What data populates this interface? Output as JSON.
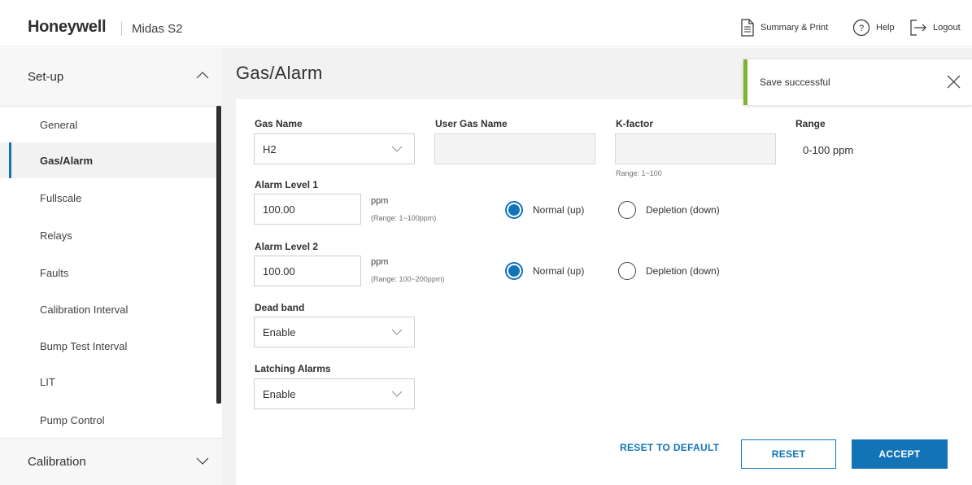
{
  "header": {
    "brand": "Honeywell",
    "product": "Midas S2",
    "summary_print": "Summary & Print",
    "help": "Help",
    "logout": "Logout"
  },
  "sidebar": {
    "setup_label": "Set-up",
    "calibration_label": "Calibration",
    "items": [
      {
        "label": "General"
      },
      {
        "label": "Gas/Alarm"
      },
      {
        "label": "Fullscale"
      },
      {
        "label": "Relays"
      },
      {
        "label": "Faults"
      },
      {
        "label": "Calibration Interval"
      },
      {
        "label": "Bump Test Interval"
      },
      {
        "label": "LIT"
      },
      {
        "label": "Pump Control"
      }
    ],
    "active_item": "Gas/Alarm"
  },
  "main": {
    "title": "Gas/Alarm",
    "form": {
      "gas_name_label": "Gas Name",
      "gas_name_value": "H2",
      "user_gas_name_label": "User Gas Name",
      "user_gas_name_value": "",
      "kfactor_label": "K-factor",
      "kfactor_value": "",
      "kfactor_hint": "Range: 1~100",
      "range_label": "Range",
      "range_value": "0-100 ppm",
      "alarm1_label": "Alarm Level 1",
      "alarm1_value": "100.00",
      "alarm1_unit": "ppm",
      "alarm1_range": "(Range: 1~100ppm)",
      "alarm2_label": "Alarm Level 2",
      "alarm2_value": "100.00",
      "alarm2_unit": "ppm",
      "alarm2_range": "(Range: 100~200ppm)",
      "normal_label": "Normal (up)",
      "depletion_label": "Depletion (down)",
      "deadband_label": "Dead band",
      "deadband_value": "Enable",
      "latching_label": "Latching Alarms",
      "latching_value": "Enable"
    },
    "buttons": {
      "reset_default": "RESET TO DEFAULT",
      "reset": "RESET",
      "accept": "ACCEPT"
    }
  },
  "toast": {
    "message": "Save successful"
  },
  "colors": {
    "accent": "#1274b7",
    "toast_border": "#7eb338"
  }
}
